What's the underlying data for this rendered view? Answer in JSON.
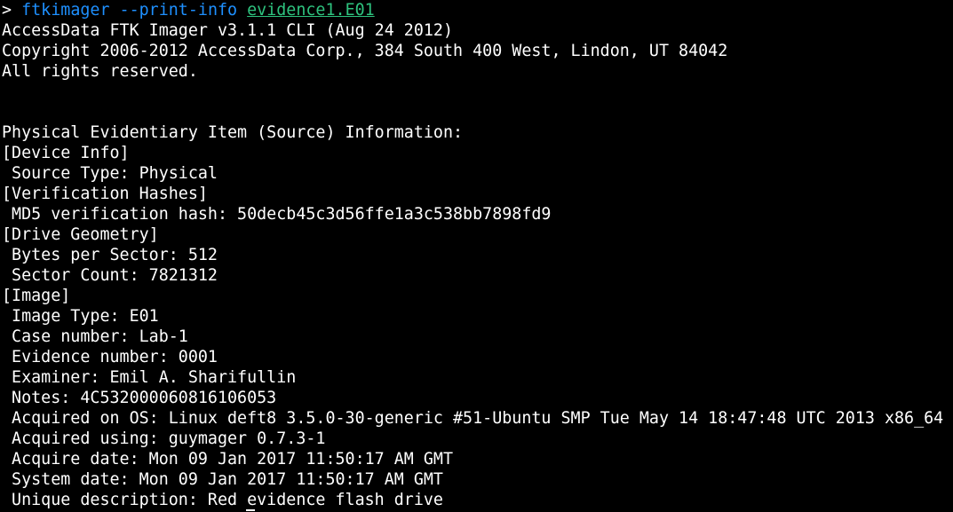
{
  "colors": {
    "background": "#000000",
    "text": "#ffffff",
    "command": "#1e90ff",
    "argument": "#2ec27e"
  },
  "prompt": {
    "symbol": "> ",
    "command": "ftkimager",
    "flag": "--print-info",
    "argument": "evidence1.E01"
  },
  "lines": [
    "AccessData FTK Imager v3.1.1 CLI (Aug 24 2012)",
    "Copyright 2006-2012 AccessData Corp., 384 South 400 West, Lindon, UT 84042",
    "All rights reserved.",
    "",
    "",
    "Physical Evidentiary Item (Source) Information:",
    "[Device Info]",
    " Source Type: Physical",
    "[Verification Hashes]",
    " MD5 verification hash: 50decb45c3d56ffe1a3c538bb7898fd9",
    "[Drive Geometry]",
    " Bytes per Sector: 512",
    " Sector Count: 7821312",
    "[Image]",
    " Image Type: E01",
    " Case number: Lab-1",
    " Evidence number: 0001",
    " Examiner: Emil A. Sharifullin",
    " Notes: 4C532000060816106053",
    " Acquired on OS: Linux deft8 3.5.0-30-generic #51-Ubuntu SMP Tue May 14 18:47:48 UTC 2013 x86_64",
    " Acquired using: guymager 0.7.3-1",
    " Acquire date: Mon 09 Jan 2017 11:50:17 AM GMT",
    " System date: Mon 09 Jan 2017 11:50:17 AM GMT",
    " Unique description: Red evidence flash drive"
  ]
}
